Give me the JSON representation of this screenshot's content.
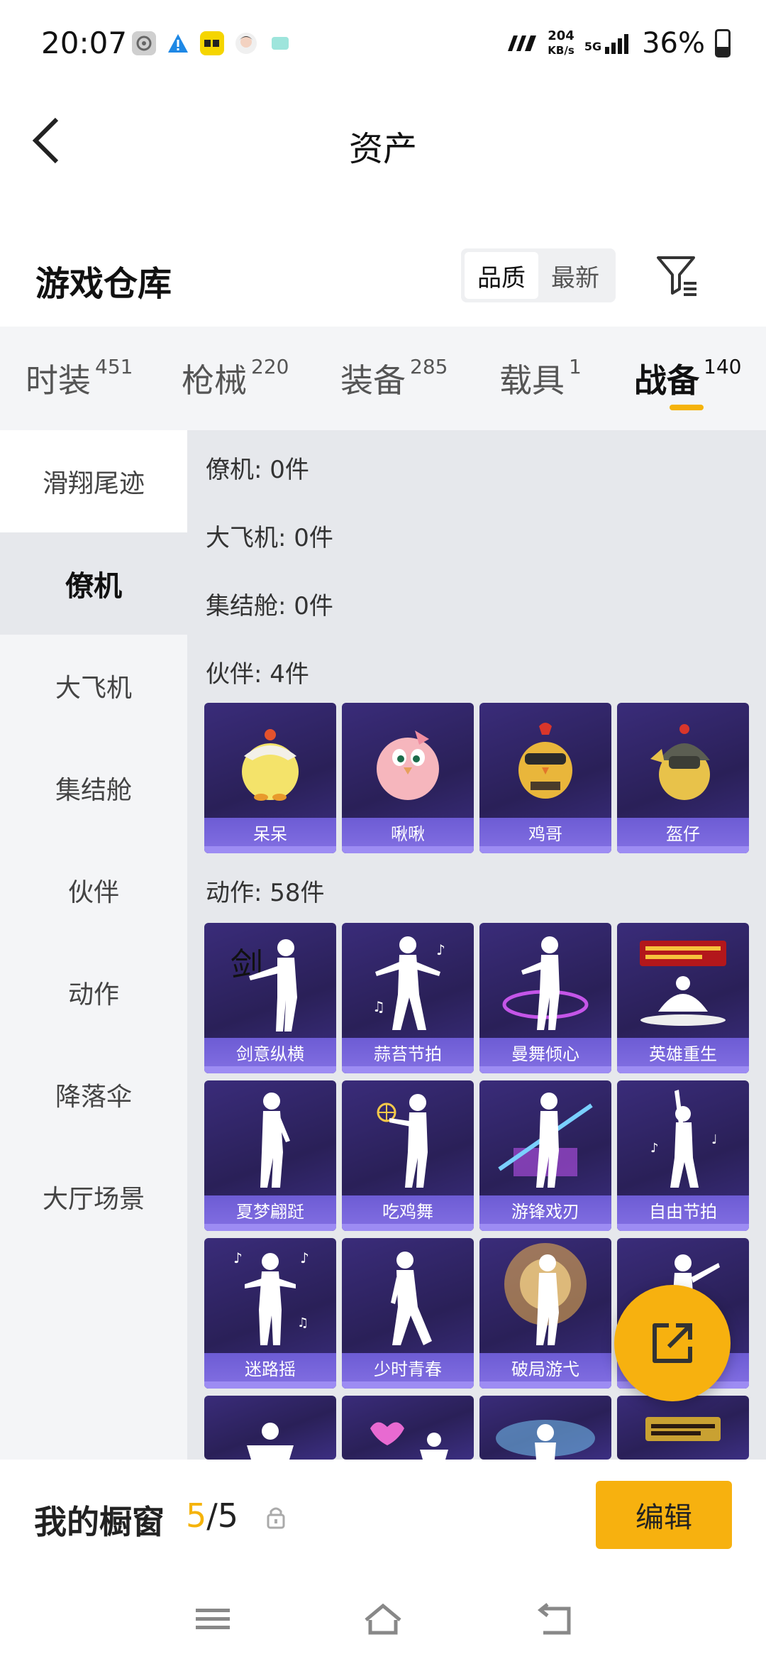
{
  "status_bar": {
    "time": "20:07",
    "network_speed_value": "204",
    "network_speed_unit": "KB/s",
    "network_type": "5G",
    "battery": "36%"
  },
  "header": {
    "title": "资产"
  },
  "warehouse": {
    "title": "游戏仓库",
    "sort_options": [
      "品质",
      "最新"
    ],
    "sort_selected": "品质"
  },
  "tabs": [
    {
      "label": "时装",
      "count": "451"
    },
    {
      "label": "枪械",
      "count": "220"
    },
    {
      "label": "装备",
      "count": "285"
    },
    {
      "label": "载具",
      "count": "1"
    },
    {
      "label": "战备",
      "count": "140",
      "active": true
    }
  ],
  "sidebar": {
    "items": [
      "滑翔尾迹",
      "僚机",
      "大飞机",
      "集结舱",
      "伙伴",
      "动作",
      "降落伞",
      "大厅场景"
    ],
    "active": "僚机"
  },
  "content": {
    "categories": [
      {
        "title": "僚机: 0件"
      },
      {
        "title": "大飞机: 0件"
      },
      {
        "title": "集结舱: 0件"
      },
      {
        "title": "伙伴: 4件"
      },
      {
        "title": "动作: 58件"
      }
    ],
    "partners": [
      "呆呆",
      "啾啾",
      "鸡哥",
      "盔仔"
    ],
    "actions": [
      "剑意纵横",
      "蒜苔节拍",
      "曼舞倾心",
      "英雄重生",
      "夏梦翩跹",
      "吃鸡舞",
      "游锋戏刃",
      "自由节拍",
      "迷路摇",
      "少时青春",
      "破局游弋",
      ""
    ]
  },
  "showcase": {
    "label": "我的橱窗",
    "current": "5",
    "separator": "/",
    "total": "5",
    "edit_label": "编辑"
  },
  "colors": {
    "accent": "#f7b10f",
    "card_bg": "#2a2058",
    "card_label": "#7f6ce0"
  }
}
